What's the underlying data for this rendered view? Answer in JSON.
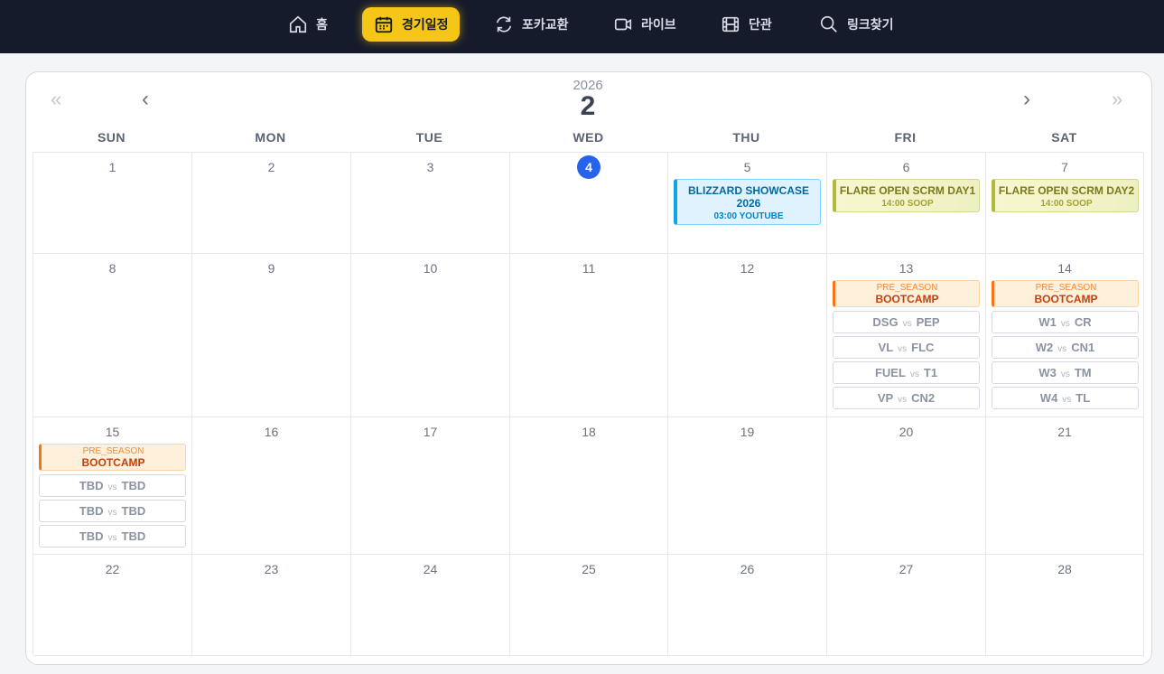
{
  "nav": [
    {
      "label": "홈",
      "icon": "home-icon"
    },
    {
      "label": "경기일정",
      "icon": "calendar-icon",
      "active": true
    },
    {
      "label": "포카교환",
      "icon": "exchange-icon"
    },
    {
      "label": "라이브",
      "icon": "video-icon"
    },
    {
      "label": "단관",
      "icon": "film-icon"
    },
    {
      "label": "링크찾기",
      "icon": "search-icon"
    }
  ],
  "calendar": {
    "year": "2026",
    "month": "2",
    "prev_year": "«",
    "prev_month": "‹",
    "next_month": "›",
    "next_year": "»",
    "weekdays": [
      "SUN",
      "MON",
      "TUE",
      "WED",
      "THU",
      "FRI",
      "SAT"
    ],
    "today": "4",
    "weeks": [
      [
        "1",
        "2",
        "3",
        "4",
        "5",
        "6",
        "7"
      ],
      [
        "8",
        "9",
        "10",
        "11",
        "12",
        "13",
        "14"
      ],
      [
        "15",
        "16",
        "17",
        "18",
        "19",
        "20",
        "21"
      ],
      [
        "22",
        "23",
        "24",
        "25",
        "26",
        "27",
        "28"
      ]
    ]
  },
  "events": {
    "d5": {
      "title": "BLIZZARD SHOWCASE 2026",
      "sub": "03:00 YOUTUBE"
    },
    "d6": {
      "title": "FLARE OPEN SCRM DAY1",
      "sub": "14:00 SOOP"
    },
    "d7": {
      "title": "FLARE OPEN SCRM DAY2",
      "sub": "14:00 SOOP"
    },
    "bootcamp": {
      "tag": "PRE_SEASON",
      "title": "BOOTCAMP"
    },
    "vs_label": "vs",
    "d13_matches": [
      [
        "DSG",
        "PEP"
      ],
      [
        "VL",
        "FLC"
      ],
      [
        "FUEL",
        "T1"
      ],
      [
        "VP",
        "CN2"
      ]
    ],
    "d14_matches": [
      [
        "W1",
        "CR"
      ],
      [
        "W2",
        "CN1"
      ],
      [
        "W3",
        "TM"
      ],
      [
        "W4",
        "TL"
      ]
    ],
    "d15_matches": [
      [
        "TBD",
        "TBD"
      ],
      [
        "TBD",
        "TBD"
      ],
      [
        "TBD",
        "TBD"
      ]
    ]
  },
  "colors": {
    "topbar": "#161b2b",
    "active_nav": "#f5c518",
    "today": "#2563eb",
    "bootcamp_accent": "#f97316",
    "showcase_accent": "#0ea5e9",
    "scrim_accent": "#b4b83c"
  }
}
